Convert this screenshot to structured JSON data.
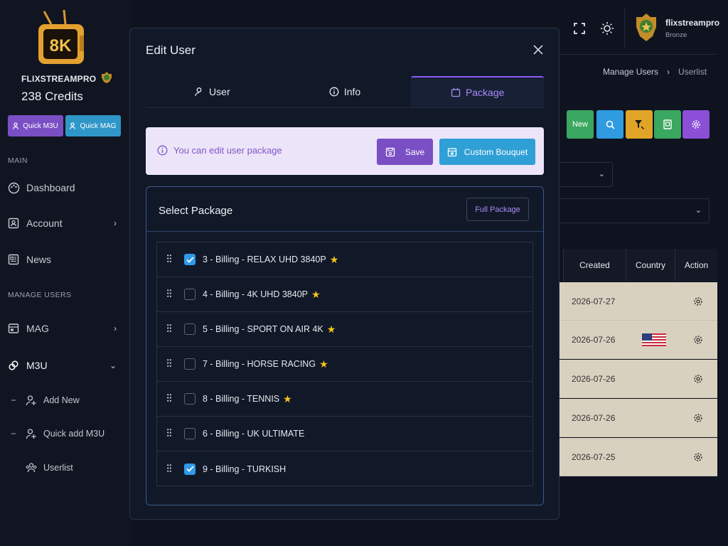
{
  "brand": {
    "name": "FLIXSTREAMPRO",
    "credits": "238 Credits",
    "logo_text": "8K"
  },
  "quick": {
    "m3u": "Quick M3U",
    "mag": "Quick MAG"
  },
  "sidebar": {
    "main_label": "MAIN",
    "manage_label": "MANAGE USERS",
    "items": [
      {
        "label": "Dashboard"
      },
      {
        "label": "Account"
      },
      {
        "label": "News"
      },
      {
        "label": "MAG"
      },
      {
        "label": "M3U"
      }
    ],
    "m3u_sub": [
      {
        "label": "Add New"
      },
      {
        "label": "Quick add M3U"
      },
      {
        "label": "Userlist"
      }
    ]
  },
  "user": {
    "name": "flixstreampro",
    "role": "Bronze"
  },
  "breadcrumb": {
    "parent": "Manage Users",
    "current": "Userlist"
  },
  "toolbar": {
    "new_label": "New"
  },
  "table": {
    "headers": [
      "Created",
      "Country",
      "Action"
    ],
    "rows": [
      {
        "created": "2026-07-27",
        "flag": false
      },
      {
        "created": "2026-07-26",
        "flag": true
      },
      {
        "created": "2026-07-26",
        "flag": false
      },
      {
        "created": "2026-07-26",
        "flag": false
      },
      {
        "created": "2026-07-25",
        "flag": false
      }
    ]
  },
  "modal": {
    "title": "Edit User",
    "tabs": [
      {
        "label": "User"
      },
      {
        "label": "Info"
      },
      {
        "label": "Package"
      }
    ],
    "active_tab": "Package",
    "alert_text": "You can edit user package",
    "save_label": "Save",
    "custom_bouquet_label": "Custom Bouquet",
    "select_title": "Select Package",
    "full_package_label": "Full Package",
    "packages": [
      {
        "label": "3 - Billing - RELAX UHD 3840P",
        "checked": true,
        "star": true
      },
      {
        "label": "4 - Billing - 4K UHD 3840P",
        "checked": false,
        "star": true
      },
      {
        "label": "5 - Billing - SPORT ON AIR 4K",
        "checked": false,
        "star": true
      },
      {
        "label": "7 - Billing - HORSE RACING",
        "checked": false,
        "star": true
      },
      {
        "label": "8 - Billing - TENNIS",
        "checked": false,
        "star": true
      },
      {
        "label": "6 - Billing - UK ULTIMATE",
        "checked": false,
        "star": false
      },
      {
        "label": "9 - Billing - TURKISH",
        "checked": true,
        "star": false
      }
    ]
  },
  "colors": {
    "accent": "#8b5cf6",
    "info": "#2fa0d6",
    "success": "#3aa860",
    "warning": "#e0a526"
  }
}
